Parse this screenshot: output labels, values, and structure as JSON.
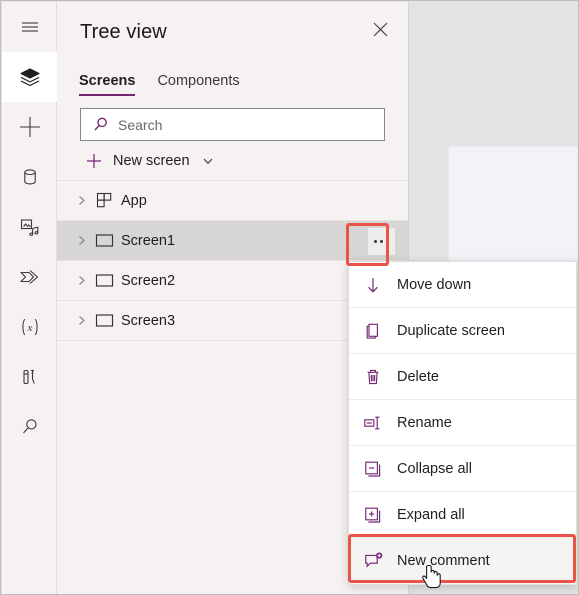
{
  "panel": {
    "title": "Tree view",
    "close_icon": "close-icon",
    "tabs": [
      {
        "label": "Screens",
        "active": true
      },
      {
        "label": "Components",
        "active": false
      }
    ],
    "search": {
      "placeholder": "Search",
      "value": "",
      "icon": "search-icon"
    },
    "new_screen": {
      "label": "New screen",
      "plus_icon": "plus-icon",
      "chevron_icon": "chevron-down-icon"
    },
    "tree_items": [
      {
        "label": "App",
        "icon": "app-grid-icon",
        "twisty": "chevron-right-icon",
        "selected": false,
        "has_ellipsis": false
      },
      {
        "label": "Screen1",
        "icon": "screen-icon",
        "twisty": "chevron-right-icon",
        "selected": true,
        "has_ellipsis": true
      },
      {
        "label": "Screen2",
        "icon": "screen-icon",
        "twisty": "chevron-right-icon",
        "selected": false,
        "has_ellipsis": false
      },
      {
        "label": "Screen3",
        "icon": "screen-icon",
        "twisty": "chevron-right-icon",
        "selected": false,
        "has_ellipsis": false
      }
    ]
  },
  "rail": {
    "items": [
      {
        "name": "hamburger-menu-icon",
        "selected": false
      },
      {
        "name": "tree-view-layers-icon",
        "selected": true
      },
      {
        "name": "insert-plus-icon",
        "selected": false
      },
      {
        "name": "data-cylinder-icon",
        "selected": false
      },
      {
        "name": "media-icon",
        "selected": false
      },
      {
        "name": "power-automate-icon",
        "selected": false
      },
      {
        "name": "variables-fx-icon",
        "selected": false
      },
      {
        "name": "app-checker-icon",
        "selected": false
      },
      {
        "name": "search-icon",
        "selected": false
      }
    ]
  },
  "context_menu": {
    "items": [
      {
        "label": "Move down",
        "icon": "arrow-down-icon",
        "hover": false
      },
      {
        "label": "Duplicate screen",
        "icon": "duplicate-icon",
        "hover": false
      },
      {
        "label": "Delete",
        "icon": "trash-icon",
        "hover": false
      },
      {
        "label": "Rename",
        "icon": "rename-icon",
        "hover": false
      },
      {
        "label": "Collapse all",
        "icon": "collapse-all-icon",
        "hover": false
      },
      {
        "label": "Expand all",
        "icon": "expand-all-icon",
        "hover": false
      },
      {
        "label": "New comment",
        "icon": "new-comment-icon",
        "hover": true
      }
    ]
  },
  "annotations": {
    "color": "#e8544a",
    "boxes": [
      {
        "target": "ellipsis-button"
      },
      {
        "target": "new-comment-menu-item"
      }
    ]
  },
  "colors": {
    "accent": "#742774",
    "panel_bg": "#f5f2f1",
    "selected_row": "#d8d6d4",
    "canvas": "#f2f3f8",
    "annotation": "#e8544a"
  },
  "cursor": {
    "type": "pointer-hand"
  }
}
